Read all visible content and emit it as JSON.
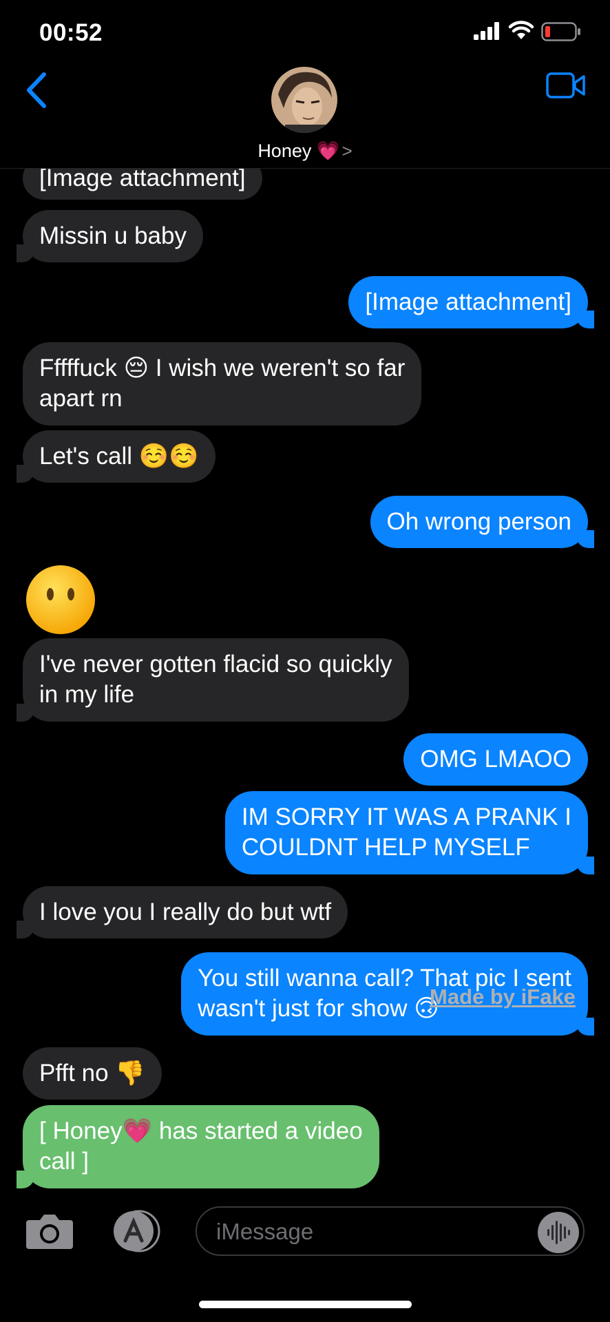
{
  "status": {
    "time": "00:52"
  },
  "header": {
    "contact_name": "Honey 💗",
    "chevron": ">"
  },
  "messages": [
    {
      "side": "in",
      "text": "[Image attachment]"
    },
    {
      "side": "in",
      "text": "Missin u baby"
    },
    {
      "side": "out",
      "text": "[Image attachment]"
    },
    {
      "side": "in",
      "text": "Fffffuck 😔 I wish we weren't so far\napart rn"
    },
    {
      "side": "in",
      "text": "Let's call ☺️☺️"
    },
    {
      "side": "out",
      "text": "Oh wrong person"
    },
    {
      "side": "in",
      "text": "😶"
    },
    {
      "side": "in",
      "text": "I've never gotten flacid so quickly\nin my life"
    },
    {
      "side": "out",
      "text": "OMG LMAOO"
    },
    {
      "side": "out",
      "text": "IM SORRY IT WAS A PRANK I\nCOULDNT HELP MYSELF"
    },
    {
      "side": "in",
      "text": "I love you I really do but wtf"
    },
    {
      "side": "out",
      "text": "You still wanna call? That pic I sent\nwasn't just for show 🙃"
    },
    {
      "side": "in",
      "text": "Pfft no 👎"
    },
    {
      "side": "in-green",
      "text": "[ Honey💗 has started a video\ncall ]"
    }
  ],
  "watermark": "Made by iFake",
  "input": {
    "placeholder": "iMessage"
  },
  "colors": {
    "accent": "#0a84ff",
    "incoming": "#262628",
    "green": "#68bf6e"
  }
}
